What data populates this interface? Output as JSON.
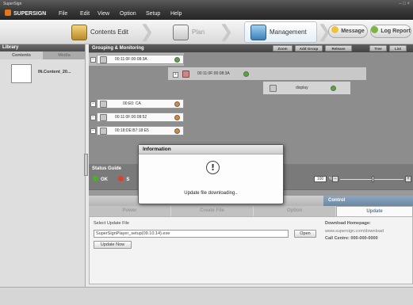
{
  "window": {
    "title": "SuperSign",
    "controls": "– □ ×"
  },
  "menu": {
    "logo": "SUPERSIGN",
    "items": [
      "File",
      "Edit",
      "View",
      "Option",
      "Setup",
      "Help"
    ]
  },
  "workflow": {
    "steps": [
      {
        "label": "Contents Edit"
      },
      {
        "label": "Plan"
      },
      {
        "label": "Management"
      }
    ],
    "message_label": "Message",
    "log_report_label": "Log Report"
  },
  "library": {
    "title": "Library",
    "tabs": [
      "Contents",
      "Media"
    ],
    "item_label": "IN.Content_20..."
  },
  "grouping": {
    "title": "Grouping & Monitoring",
    "buttons": [
      "Zoom",
      "Add Group",
      "Release",
      "Tree",
      "List"
    ],
    "devices": [
      {
        "id": "00:11:0F:00:08:3A",
        "status": "ok"
      },
      {
        "id": "00:11:0F:00:08:3A",
        "status": "ok"
      },
      {
        "id": "display",
        "status": "ok"
      },
      {
        "id": "00:E0: CA",
        "status": "warn"
      },
      {
        "id": "00:11:0F:00:08:52",
        "status": "warn"
      },
      {
        "id": "00:18:DE:B7:18:E5",
        "status": "warn"
      }
    ]
  },
  "status_guide": {
    "title": "Status Guide",
    "ok_label": "OK",
    "ng_label": "S",
    "zoom_value": "100",
    "zoom_percent": "%"
  },
  "control": {
    "title": "Control",
    "tabs": [
      "Power",
      "Create File",
      "Option",
      "Update"
    ],
    "active_tab": "Update",
    "select_label": "Select Update File",
    "file_value": "SuperSignPlayer_setup(09.10.14).exe",
    "open_label": "Open",
    "update_now_label": "Update Now",
    "download_label": "Download Homepage:",
    "download_url": "www.supersign.com/download",
    "call_centre": "Call Centre: 000-000-0000"
  },
  "dialog": {
    "title": "Information",
    "icon": "!",
    "message": "Update file downloading.."
  },
  "colors": {
    "ok": "#4caf2a",
    "warn": "#e8832a",
    "accent": "#6f8aa7"
  }
}
